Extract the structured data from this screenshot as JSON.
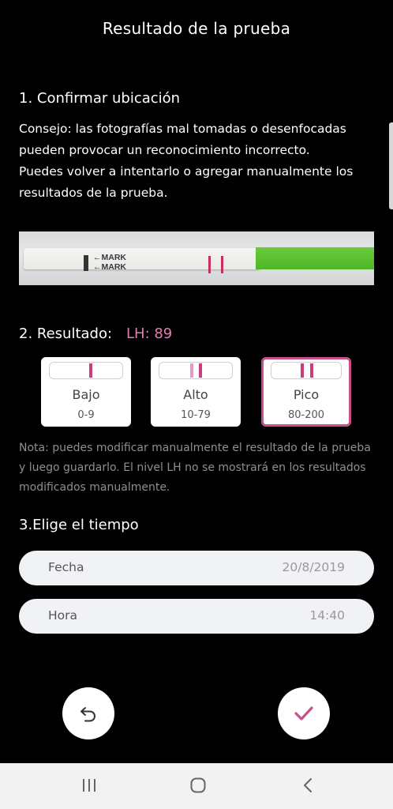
{
  "header": {
    "title": "Resultado de la prueba"
  },
  "section1": {
    "heading": "1. Confirmar ubicación",
    "tip_lines": [
      "Consejo: las fotografías mal tomadas o desenfocadas",
      "pueden provocar un reconocimiento incorrecto.",
      "Puedes volver a intentarlo o agregar manualmente los",
      "resultados de la prueba."
    ],
    "strip_marks": [
      "MARK",
      "MARK"
    ]
  },
  "section2": {
    "heading": "2. Resultado:",
    "lh_value": "LH: 89",
    "levels": [
      {
        "name": "Bajo",
        "range": "0-9",
        "selected": false
      },
      {
        "name": "Alto",
        "range": "10-79",
        "selected": false
      },
      {
        "name": "Pico",
        "range": "80-200",
        "selected": true
      }
    ],
    "note_lines": [
      "Nota: puedes modificar manualmente el resultado de la prueba",
      "y luego guardarlo. El nivel LH no se mostrará en los resultados",
      "modificados manualmente."
    ]
  },
  "section3": {
    "heading": "3.Elige el tiempo",
    "date": {
      "label": "Fecha",
      "value": "20/8/2019"
    },
    "time": {
      "label": "Hora",
      "value": "14:40"
    }
  },
  "actions": {
    "back_icon": "undo-icon",
    "confirm_icon": "check-icon"
  },
  "navbar": {
    "icons": [
      "recent-apps-icon",
      "home-icon",
      "back-icon"
    ]
  },
  "colors": {
    "accent": "#c94f8a",
    "accent_light": "#e07fb3",
    "band": "#cc3c7d"
  }
}
